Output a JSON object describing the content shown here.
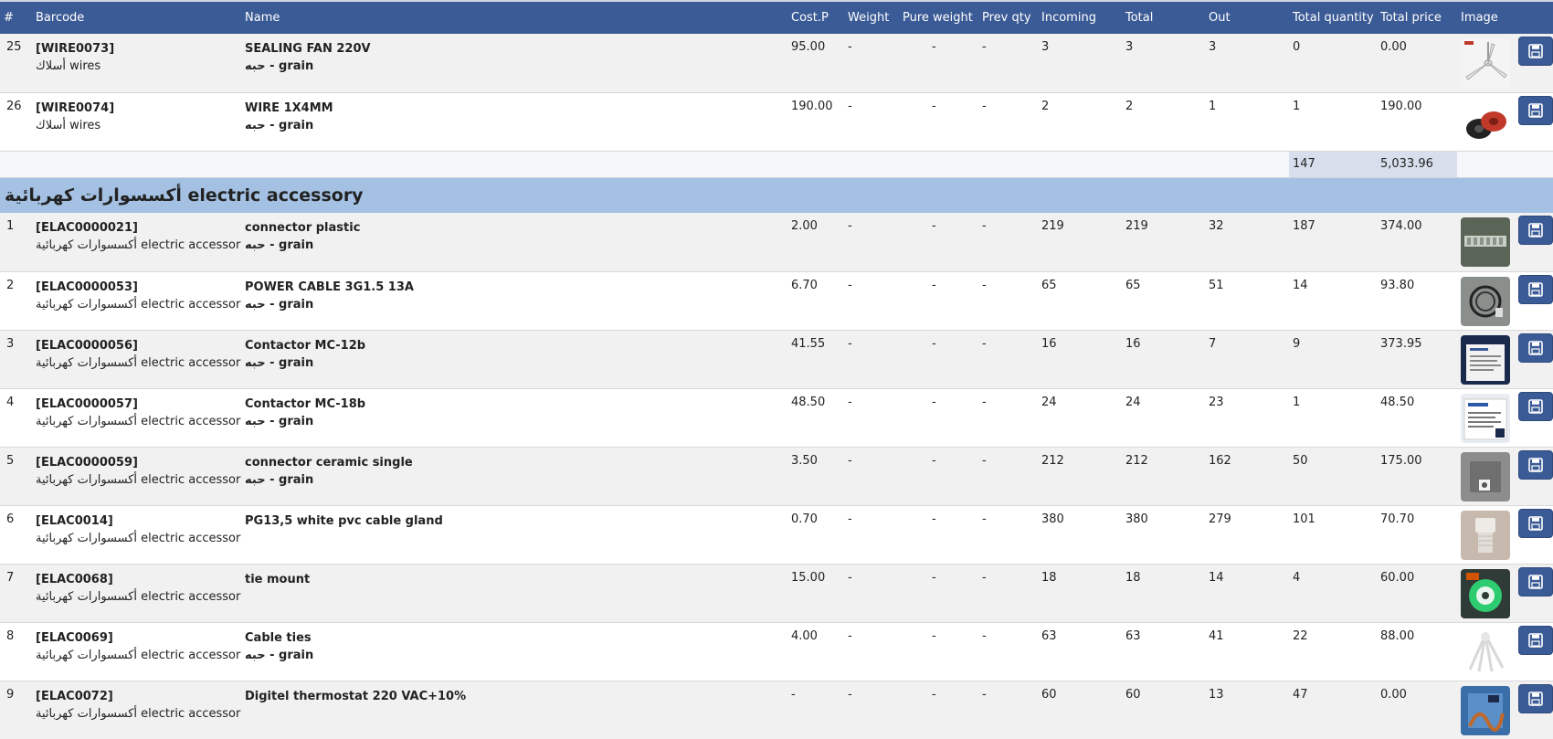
{
  "columns": [
    "#",
    "Barcode",
    "Name",
    "Cost.P",
    "Weight",
    "Pure weight",
    "Prev qty",
    "Incoming",
    "Total",
    "Out",
    "Total quantity",
    "Total price",
    "Image"
  ],
  "rows_before": [
    {
      "num": "25",
      "barcode": "[WIRE0073]",
      "category": "أسلاك wires",
      "name": "SEALING FAN 220V",
      "unit": "حبه - grain",
      "cost": "95.00",
      "weight": "-",
      "pure": "-",
      "prev": "-",
      "incoming": "3",
      "total": "3",
      "out": "3",
      "tq": "0",
      "tp": "0.00",
      "image": "ceiling-fan-thumbnail"
    },
    {
      "num": "26",
      "barcode": "[WIRE0074]",
      "category": "أسلاك wires",
      "name": "WIRE 1X4MM",
      "unit": "حبه - grain",
      "cost": "190.00",
      "weight": "-",
      "pure": "-",
      "prev": "-",
      "incoming": "2",
      "total": "2",
      "out": "1",
      "tq": "1",
      "tp": "190.00",
      "image": "wire-coil-thumbnail"
    }
  ],
  "subtotal": {
    "total_quantity": "147",
    "total_price": "5,033.96"
  },
  "group": {
    "title": "أكسسوارات كهربائية electric accessory"
  },
  "rows_after": [
    {
      "num": "1",
      "barcode": "[ELAC0000021]",
      "category": "أكسسوارات كهربائية electric accessory",
      "name": "connector plastic",
      "unit": "حبه - grain",
      "cost": "2.00",
      "weight": "-",
      "pure": "-",
      "prev": "-",
      "incoming": "219",
      "total": "219",
      "out": "32",
      "tq": "187",
      "tp": "374.00",
      "image": "connector-thumbnail"
    },
    {
      "num": "2",
      "barcode": "[ELAC0000053]",
      "category": "أكسسوارات كهربائية electric accessory",
      "name": "POWER CABLE 3G1.5 13A",
      "unit": "حبه - grain",
      "cost": "6.70",
      "weight": "-",
      "pure": "-",
      "prev": "-",
      "incoming": "65",
      "total": "65",
      "out": "51",
      "tq": "14",
      "tp": "93.80",
      "image": "power-cable-thumbnail"
    },
    {
      "num": "3",
      "barcode": "[ELAC0000056]",
      "category": "أكسسوارات كهربائية electric accessory",
      "name": "Contactor MC-12b",
      "unit": "حبه - grain",
      "cost": "41.55",
      "weight": "-",
      "pure": "-",
      "prev": "-",
      "incoming": "16",
      "total": "16",
      "out": "7",
      "tq": "9",
      "tp": "373.95",
      "image": "contactor-box-thumbnail"
    },
    {
      "num": "4",
      "barcode": "[ELAC0000057]",
      "category": "أكسسوارات كهربائية electric accessory",
      "name": "Contactor MC-18b",
      "unit": "حبه - grain",
      "cost": "48.50",
      "weight": "-",
      "pure": "-",
      "prev": "-",
      "incoming": "24",
      "total": "24",
      "out": "23",
      "tq": "1",
      "tp": "48.50",
      "image": "contactor-box-white-thumbnail"
    },
    {
      "num": "5",
      "barcode": "[ELAC0000059]",
      "category": "أكسسوارات كهربائية electric accessory",
      "name": "connector ceramic single",
      "unit": "حبه - grain",
      "cost": "3.50",
      "weight": "-",
      "pure": "-",
      "prev": "-",
      "incoming": "212",
      "total": "212",
      "out": "162",
      "tq": "50",
      "tp": "175.00",
      "image": "ceramic-connector-thumbnail"
    },
    {
      "num": "6",
      "barcode": "[ELAC0014]",
      "category": "أكسسوارات كهربائية electric accessory",
      "name": "PG13,5 white pvc cable gland",
      "unit": "",
      "cost": "0.70",
      "weight": "-",
      "pure": "-",
      "prev": "-",
      "incoming": "380",
      "total": "380",
      "out": "279",
      "tq": "101",
      "tp": "70.70",
      "image": "cable-gland-thumbnail"
    },
    {
      "num": "7",
      "barcode": "[ELAC0068]",
      "category": "أكسسوارات كهربائية electric accessory",
      "name": "tie mount",
      "unit": "",
      "cost": "15.00",
      "weight": "-",
      "pure": "-",
      "prev": "-",
      "incoming": "18",
      "total": "18",
      "out": "14",
      "tq": "4",
      "tp": "60.00",
      "image": "tie-mount-thumbnail"
    },
    {
      "num": "8",
      "barcode": "[ELAC0069]",
      "category": "أكسسوارات كهربائية electric accessory",
      "name": "Cable ties",
      "unit": "حبه - grain",
      "cost": "4.00",
      "weight": "-",
      "pure": "-",
      "prev": "-",
      "incoming": "63",
      "total": "63",
      "out": "41",
      "tq": "22",
      "tp": "88.00",
      "image": "cable-ties-thumbnail"
    },
    {
      "num": "9",
      "barcode": "[ELAC0072]",
      "category": "أكسسوارات كهربائية electric accessory",
      "name": "Digitel thermostat 220 VAC+10%",
      "unit": "",
      "cost": "-",
      "weight": "-",
      "pure": "-",
      "prev": "-",
      "incoming": "60",
      "total": "60",
      "out": "13",
      "tq": "47",
      "tp": "0.00",
      "image": "thermostat-thumbnail"
    }
  ],
  "colors": {
    "header": "#3b5b96",
    "group_band": "#a4c1e3",
    "row_alt": "#f1f1f1",
    "subtotal_highlight": "#d7dfec",
    "button": "#3b5b96"
  },
  "icons": {
    "row_action": "save-icon"
  }
}
